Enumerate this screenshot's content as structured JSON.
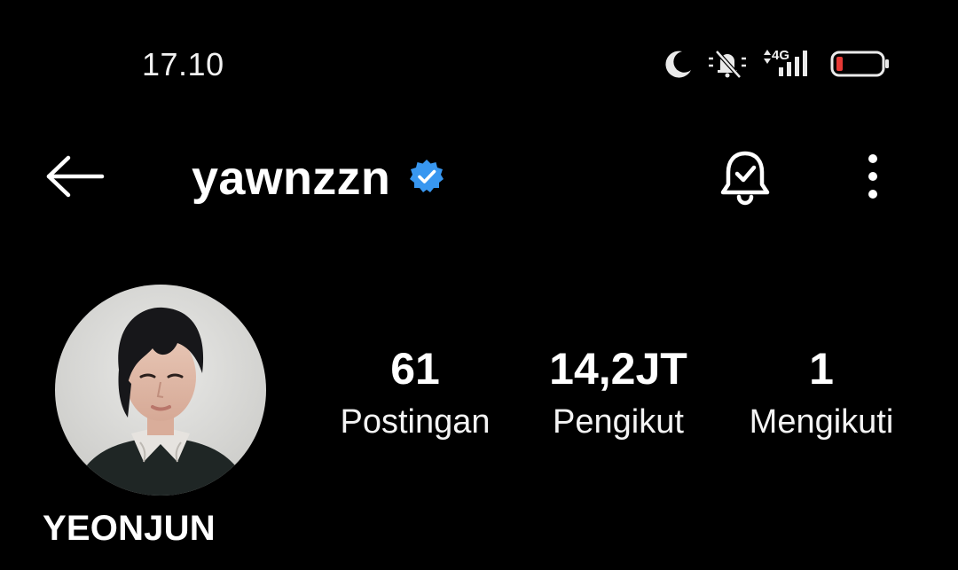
{
  "status_bar": {
    "time": "17.10",
    "network": "4G",
    "icons": [
      "moon-icon",
      "bell-off-icon",
      "signal-icon",
      "battery-low-icon"
    ],
    "battery_color": "#e53935"
  },
  "header": {
    "username": "yawnzzn",
    "verified": true,
    "verified_color": "#3897f0",
    "icons": [
      "back-arrow-icon",
      "bell-check-icon",
      "more-vertical-icon"
    ]
  },
  "profile": {
    "display_name": "YEONJUN",
    "avatar_description": "profile-photo"
  },
  "stats": [
    {
      "value": "61",
      "label": "Postingan"
    },
    {
      "value": "14,2JT",
      "label": "Pengikut"
    },
    {
      "value": "1",
      "label": "Mengikuti"
    }
  ]
}
